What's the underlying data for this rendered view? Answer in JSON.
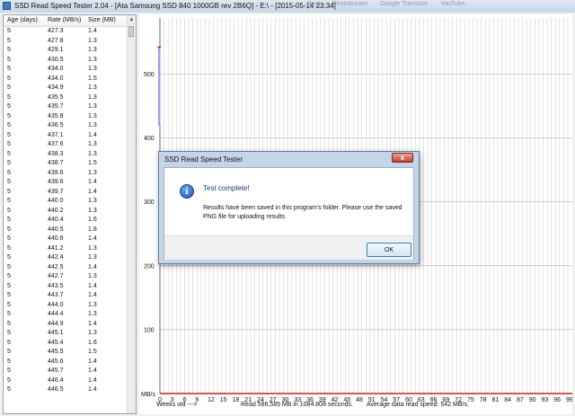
{
  "window": {
    "title": "SSD Read Speed Tester 2.04 - [Ata Samsung SSD 840 1000GB rev 2B6Q] - E:\\ - [2015-05-14 23:34]",
    "background_tabs": [
      "Bing",
      "Photobucket",
      "Google Translate",
      "YouTube"
    ]
  },
  "list": {
    "headers": [
      "Age (days)",
      "Rate (MB/s)",
      "Size (MB)"
    ],
    "rows": [
      [
        "5",
        "427.3",
        "1.4"
      ],
      [
        "5",
        "427.8",
        "1.3"
      ],
      [
        "5",
        "429.1",
        "1.3"
      ],
      [
        "5",
        "430.5",
        "1.3"
      ],
      [
        "5",
        "434.0",
        "1.3"
      ],
      [
        "5",
        "434.0",
        "1.5"
      ],
      [
        "5",
        "434.9",
        "1.3"
      ],
      [
        "5",
        "435.5",
        "1.3"
      ],
      [
        "5",
        "435.7",
        "1.3"
      ],
      [
        "5",
        "435.8",
        "1.3"
      ],
      [
        "5",
        "436.5",
        "1.3"
      ],
      [
        "5",
        "437.1",
        "1.4"
      ],
      [
        "5",
        "437.6",
        "1.3"
      ],
      [
        "5",
        "438.3",
        "1.3"
      ],
      [
        "5",
        "438.7",
        "1.5"
      ],
      [
        "5",
        "439.6",
        "1.3"
      ],
      [
        "5",
        "439.6",
        "1.4"
      ],
      [
        "5",
        "439.7",
        "1.4"
      ],
      [
        "5",
        "440.0",
        "1.3"
      ],
      [
        "5",
        "440.2",
        "1.3"
      ],
      [
        "5",
        "440.4",
        "1.6"
      ],
      [
        "5",
        "440.5",
        "1.8"
      ],
      [
        "5",
        "440.6",
        "1.4"
      ],
      [
        "5",
        "441.2",
        "1.3"
      ],
      [
        "5",
        "442.4",
        "1.3"
      ],
      [
        "5",
        "442.5",
        "1.4"
      ],
      [
        "5",
        "442.7",
        "1.3"
      ],
      [
        "5",
        "443.5",
        "1.4"
      ],
      [
        "5",
        "443.7",
        "1.4"
      ],
      [
        "5",
        "444.0",
        "1.3"
      ],
      [
        "5",
        "444.4",
        "1.3"
      ],
      [
        "5",
        "444.9",
        "1.4"
      ],
      [
        "5",
        "445.1",
        "1.3"
      ],
      [
        "5",
        "445.4",
        "1.6"
      ],
      [
        "5",
        "445.5",
        "1.5"
      ],
      [
        "5",
        "445.6",
        "1.4"
      ],
      [
        "5",
        "445.7",
        "1.4"
      ],
      [
        "5",
        "446.4",
        "1.4"
      ],
      [
        "5",
        "446.5",
        "1.4"
      ]
    ]
  },
  "chart": {
    "y_unit_label": "MB/s",
    "y_ticks": [
      "100",
      "200",
      "300",
      "400",
      "500"
    ],
    "x_ticks": [
      "0",
      "3",
      "6",
      "9",
      "12",
      "15",
      "18",
      "21",
      "24",
      "27",
      "30",
      "33",
      "36",
      "39",
      "42",
      "45",
      "48",
      "51",
      "54",
      "57",
      "60",
      "63",
      "66",
      "69",
      "72",
      "75",
      "78",
      "81",
      "84",
      "87",
      "90",
      "93",
      "96",
      "99"
    ],
    "weeks_label": "Weeks old --->",
    "read_info": "Read 586,585 MB in 1084.808 seconds.",
    "avg_info": "Average data read speed: 542 MB/s.",
    "colors": {
      "bar": "#9e9ee6",
      "marker": "#c81e1e",
      "grid": "#cfcfcf"
    }
  },
  "chart_data": {
    "type": "bar",
    "title": "",
    "xlabel": "Weeks old --->",
    "ylabel": "MB/s",
    "ylim": [
      0,
      540
    ],
    "xlim": [
      0,
      99
    ],
    "grid": true,
    "x": [
      0
    ],
    "values": [
      542
    ]
  },
  "dialog": {
    "title": "SSD Read Speed Tester",
    "close_label": "x",
    "heading": "Test complete!",
    "message": "Results have been saved in this program's folder.  Please use the saved PNG file for uploading results.",
    "ok_label": "OK"
  }
}
